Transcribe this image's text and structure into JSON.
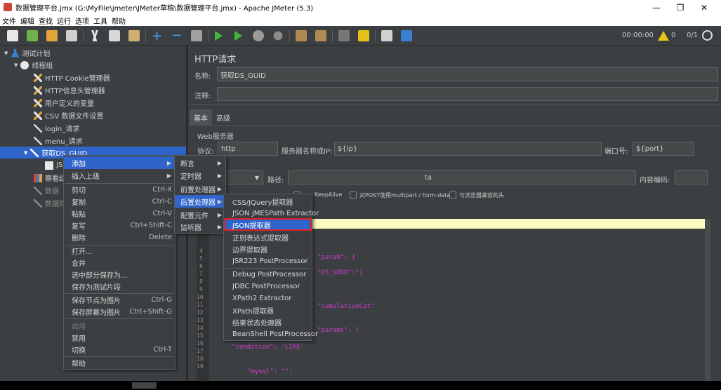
{
  "window": {
    "title": "数据管理平台.jmx (G:\\MyFile\\jmeter\\JMeter草稿\\数据管理平台.jmx) - Apache JMeter (5.3)",
    "minimize": "—",
    "maximize": "❐",
    "close": "✕"
  },
  "menubar": [
    "文件",
    "编辑",
    "查找",
    "运行",
    "选项",
    "工具",
    "帮助"
  ],
  "toolbar": {
    "timer": "00:00:00",
    "warn_count": "0",
    "threads": "0/1",
    "colors": {
      "new": "#e8e8e8",
      "open": "#6fb24a",
      "save": "#e0a43a",
      "run": "#3dbb3d",
      "stop": "#9a9a9a",
      "help": "#3a7fd0",
      "plus": "#4aa3ff",
      "warn": "#e6c21a"
    }
  },
  "tree": {
    "root": "测试计划",
    "group": "线程组",
    "items": [
      "HTTP Cookie管理器",
      "HTTP信息头管理器",
      "用户定义的变量",
      "CSV 数据文件设置",
      "login_请求",
      "menu_请求",
      "获取DS_GUID"
    ],
    "child_partial": "JS",
    "after_partial": [
      "察看结",
      "数据",
      "数据同"
    ]
  },
  "panel": {
    "title": "HTTP请求",
    "name_label": "名称:",
    "name_value": "获取DS_GUID",
    "comment_label": "注释:",
    "tab_basic": "基本",
    "tab_advanced": "高级",
    "web_server": "Web服务器",
    "protocol_label": "协议:",
    "protocol_value": "http",
    "server_label": "服务器名称或IP:",
    "server_value": "${ip}",
    "port_label": "端口号:",
    "port_value": "${port}",
    "path_label": "路径:",
    "path_value": "ta",
    "encoding_label": "内容编码:",
    "keepalive": "KeepAlive",
    "multipart": "对POST使用multipart / form-data",
    "browser_headers": "与浏览器兼容的头"
  },
  "menu1": {
    "items": [
      {
        "label": "添加",
        "key": "",
        "arrow": true,
        "hl": true
      },
      {
        "label": "插入上级",
        "key": "",
        "arrow": true
      },
      {
        "label": "剪切",
        "key": "Ctrl-X"
      },
      {
        "label": "复制",
        "key": "Ctrl-C"
      },
      {
        "label": "粘贴",
        "key": "Ctrl-V"
      },
      {
        "label": "复写",
        "key": "Ctrl+Shift-C"
      },
      {
        "label": "删除",
        "key": "Delete"
      },
      {
        "label": "打开..."
      },
      {
        "label": "合并"
      },
      {
        "label": "选中部分保存为..."
      },
      {
        "label": "保存为测试片段"
      },
      {
        "label": "保存节点为图片",
        "key": "Ctrl-G"
      },
      {
        "label": "保存屏幕为图片",
        "key": "Ctrl+Shift-G"
      },
      {
        "label": "启用",
        "disabled": true
      },
      {
        "label": "禁用"
      },
      {
        "label": "切换",
        "key": "Ctrl-T"
      },
      {
        "label": "帮助"
      }
    ]
  },
  "menu2": {
    "items": [
      "断言",
      "定时器",
      "前置处理器",
      "后置处理器",
      "配置元件",
      "监听器"
    ]
  },
  "menu3": {
    "items": [
      "CSS/JQuery提取器",
      "JSON JMESPath Extractor",
      "JSON提取器",
      "正则表达式提取器",
      "边界提取器",
      "JSR223 PostProcessor",
      "Debug PostProcessor",
      "JDBC PostProcessor",
      "XPath2 Extractor",
      "XPath提取器",
      "结果状态处理器",
      "BeanShell PostProcessor"
    ]
  },
  "editor": {
    "lines": [
      "1",
      "2",
      "3",
      "4",
      "5",
      "6",
      "7",
      "8",
      "9",
      "10",
      "11",
      "12",
      "13",
      "14",
      "15",
      "16",
      "17",
      "18",
      "19"
    ],
    "fragments": [
      "\"param\": {",
      "\"DS_GUID\":\"[",
      "\"cumulativeCat\"",
      "\"params\": {",
      "\"condition\": 'LIKE'",
      "\"mysql\": \"\","
    ]
  }
}
